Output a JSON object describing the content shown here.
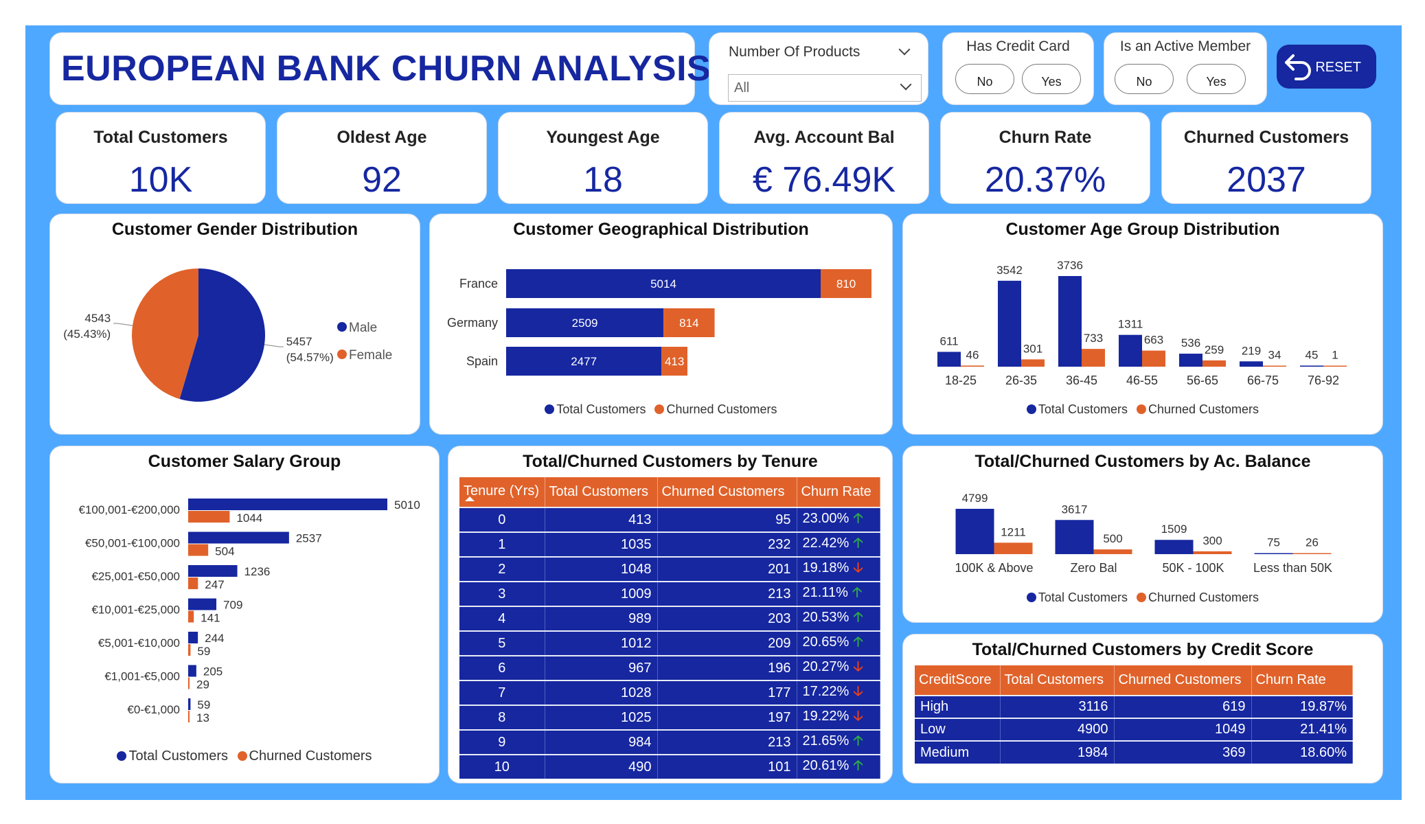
{
  "title": "EUROPEAN BANK CHURN ANALYSIS",
  "colors": {
    "total": "#1627a0",
    "churned": "#e0622a",
    "background": "#4ea8ff",
    "up_arrow": "#2ea84a",
    "down_arrow": "#e8401c"
  },
  "slicers": {
    "products": {
      "title": "Number Of Products",
      "value": "All"
    },
    "credit_card": {
      "title": "Has Credit Card",
      "options": [
        "No",
        "Yes"
      ]
    },
    "active_member": {
      "title": "Is an Active Member",
      "options": [
        "No",
        "Yes"
      ]
    },
    "reset_label": "RESET"
  },
  "kpis": [
    {
      "title": "Total Customers",
      "value": "10K"
    },
    {
      "title": "Oldest Age",
      "value": "92"
    },
    {
      "title": "Youngest Age",
      "value": "18"
    },
    {
      "title": "Avg. Account Bal",
      "value": "€ 76.49K"
    },
    {
      "title": "Churn Rate",
      "value": "20.37%"
    },
    {
      "title": "Churned Customers",
      "value": "2037"
    }
  ],
  "legend": {
    "total": "Total Customers",
    "churned": "Churned Customers",
    "male": "Male",
    "female": "Female"
  },
  "chart_data": [
    {
      "id": "gender",
      "type": "pie",
      "title": "Customer Gender Distribution",
      "categories": [
        "Male",
        "Female"
      ],
      "values": [
        5457,
        4543
      ],
      "labels": [
        "5457",
        "4543"
      ],
      "pct_labels": [
        "(54.57%)",
        "(45.43%)"
      ],
      "legend_position": "right"
    },
    {
      "id": "geo",
      "type": "bar",
      "orientation": "horizontal",
      "stacked": true,
      "title": "Customer Geographical Distribution",
      "categories": [
        "France",
        "Germany",
        "Spain"
      ],
      "series": [
        {
          "name": "Total Customers",
          "values": [
            5014,
            2509,
            2477
          ]
        },
        {
          "name": "Churned Customers",
          "values": [
            810,
            814,
            413
          ]
        }
      ],
      "legend_position": "bottom"
    },
    {
      "id": "age",
      "type": "bar",
      "title": "Customer Age Group Distribution",
      "categories": [
        "18-25",
        "26-35",
        "36-45",
        "46-55",
        "56-65",
        "66-75",
        "76-92"
      ],
      "series": [
        {
          "name": "Total Customers",
          "values": [
            611,
            3542,
            3736,
            1311,
            536,
            219,
            45
          ]
        },
        {
          "name": "Churned Customers",
          "values": [
            46,
            301,
            733,
            663,
            259,
            34,
            1
          ]
        }
      ],
      "legend_position": "bottom"
    },
    {
      "id": "salary",
      "type": "bar",
      "orientation": "horizontal",
      "title": "Customer Salary Group",
      "categories": [
        "€100,001-€200,000",
        "€50,001-€100,000",
        "€25,001-€50,000",
        "€10,001-€25,000",
        "€5,001-€10,000",
        "€1,001-€5,000",
        "€0-€1,000"
      ],
      "series": [
        {
          "name": "Total Customers",
          "values": [
            5010,
            2537,
            1236,
            709,
            244,
            205,
            59
          ]
        },
        {
          "name": "Churned Customers",
          "values": [
            1044,
            504,
            247,
            141,
            59,
            29,
            13
          ]
        }
      ],
      "legend_position": "bottom"
    },
    {
      "id": "tenure",
      "type": "table",
      "title": "Total/Churned Customers by Tenure",
      "columns": [
        "Tenure (Yrs)",
        "Total Customers",
        "Churned Customers",
        "Churn Rate"
      ],
      "rows": [
        {
          "tenure": "0",
          "total": "413",
          "churned": "95",
          "rate": "23.00%",
          "trend": "up"
        },
        {
          "tenure": "1",
          "total": "1035",
          "churned": "232",
          "rate": "22.42%",
          "trend": "up"
        },
        {
          "tenure": "2",
          "total": "1048",
          "churned": "201",
          "rate": "19.18%",
          "trend": "down"
        },
        {
          "tenure": "3",
          "total": "1009",
          "churned": "213",
          "rate": "21.11%",
          "trend": "up"
        },
        {
          "tenure": "4",
          "total": "989",
          "churned": "203",
          "rate": "20.53%",
          "trend": "up"
        },
        {
          "tenure": "5",
          "total": "1012",
          "churned": "209",
          "rate": "20.65%",
          "trend": "up"
        },
        {
          "tenure": "6",
          "total": "967",
          "churned": "196",
          "rate": "20.27%",
          "trend": "down"
        },
        {
          "tenure": "7",
          "total": "1028",
          "churned": "177",
          "rate": "17.22%",
          "trend": "down"
        },
        {
          "tenure": "8",
          "total": "1025",
          "churned": "197",
          "rate": "19.22%",
          "trend": "down"
        },
        {
          "tenure": "9",
          "total": "984",
          "churned": "213",
          "rate": "21.65%",
          "trend": "up"
        },
        {
          "tenure": "10",
          "total": "490",
          "churned": "101",
          "rate": "20.61%",
          "trend": "up"
        }
      ]
    },
    {
      "id": "balance",
      "type": "bar",
      "title": "Total/Churned Customers by Ac. Balance",
      "categories": [
        "100K & Above",
        "Zero Bal",
        "50K - 100K",
        "Less than 50K"
      ],
      "series": [
        {
          "name": "Total Customers",
          "values": [
            4799,
            3617,
            1509,
            75
          ]
        },
        {
          "name": "Churned Customers",
          "values": [
            1211,
            500,
            300,
            26
          ]
        }
      ],
      "legend_position": "bottom"
    },
    {
      "id": "credit",
      "type": "table",
      "title": "Total/Churned Customers by Credit Score",
      "columns": [
        "CreditScore",
        "Total Customers",
        "Churned Customers",
        "Churn Rate"
      ],
      "rows": [
        {
          "score": "High",
          "total": "3116",
          "churned": "619",
          "rate": "19.87%"
        },
        {
          "score": "Low",
          "total": "4900",
          "churned": "1049",
          "rate": "21.41%"
        },
        {
          "score": "Medium",
          "total": "1984",
          "churned": "369",
          "rate": "18.60%"
        }
      ]
    }
  ]
}
